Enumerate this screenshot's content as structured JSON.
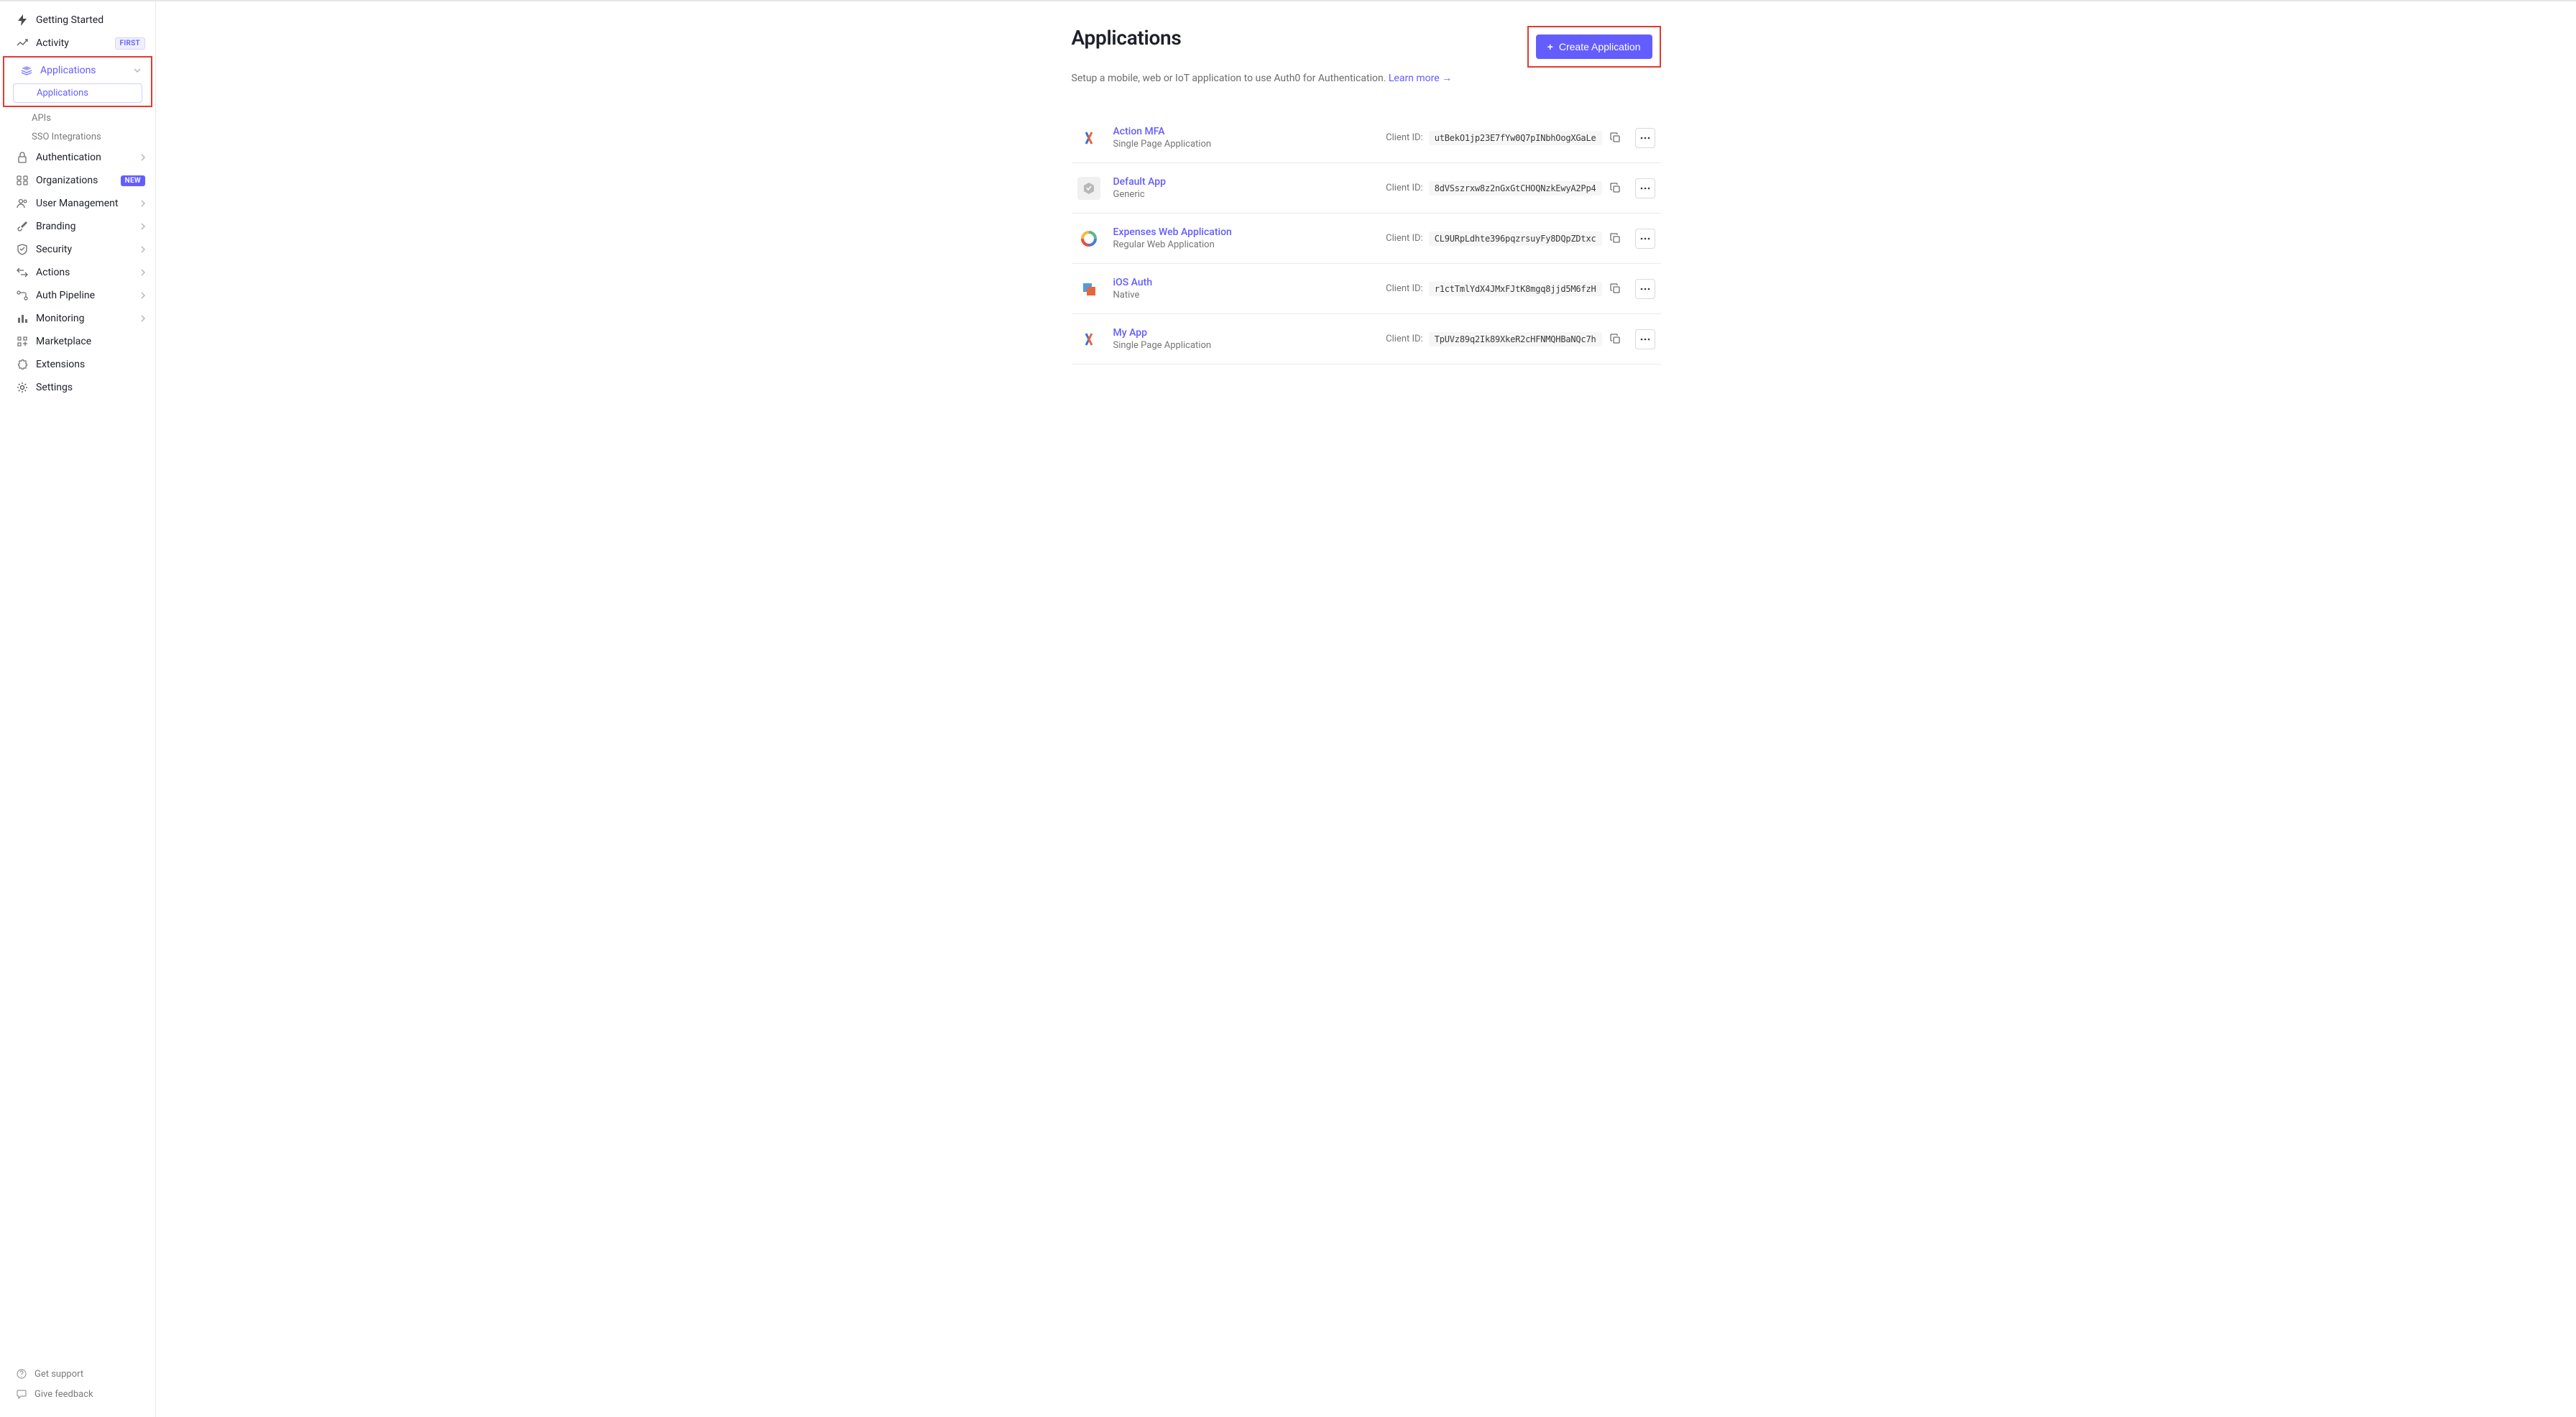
{
  "sidebar": {
    "items": [
      {
        "label": "Getting Started",
        "icon": "bolt"
      },
      {
        "label": "Activity",
        "icon": "chart",
        "badge": "FIRST",
        "badgeClass": "first"
      },
      {
        "label": "Applications",
        "icon": "layers",
        "hasChevDown": true,
        "activeParent": true,
        "subItems": [
          "Applications",
          "APIs",
          "SSO Integrations"
        ],
        "selectedSub": 0
      },
      {
        "label": "Authentication",
        "icon": "lock",
        "hasChev": true
      },
      {
        "label": "Organizations",
        "icon": "org",
        "badge": "NEW",
        "badgeClass": "new"
      },
      {
        "label": "User Management",
        "icon": "users",
        "hasChev": true
      },
      {
        "label": "Branding",
        "icon": "brush",
        "hasChev": true
      },
      {
        "label": "Security",
        "icon": "shield",
        "hasChev": true
      },
      {
        "label": "Actions",
        "icon": "arrows",
        "hasChev": true
      },
      {
        "label": "Auth Pipeline",
        "icon": "pipeline",
        "hasChev": true
      },
      {
        "label": "Monitoring",
        "icon": "bars",
        "hasChev": true
      },
      {
        "label": "Marketplace",
        "icon": "grid"
      },
      {
        "label": "Extensions",
        "icon": "puzzle"
      },
      {
        "label": "Settings",
        "icon": "gear"
      }
    ],
    "footer": [
      {
        "label": "Get support",
        "icon": "help"
      },
      {
        "label": "Give feedback",
        "icon": "comment"
      }
    ]
  },
  "page": {
    "title": "Applications",
    "subtitle_prefix": "Setup a mobile, web or IoT application to use Auth0 for Authentication. ",
    "learn_more": "Learn more →",
    "create_button": "Create Application",
    "client_id_label": "Client ID:"
  },
  "apps": [
    {
      "name": "Action MFA",
      "type": "Single Page Application",
      "clientId": "utBekO1jp23E7fYw0Q7pINbhOogXGaLe",
      "iconKind": "spa"
    },
    {
      "name": "Default App",
      "type": "Generic",
      "clientId": "8dVSszrxw8z2nGxGtCHOQNzkEwyA2Pp4",
      "iconKind": "generic"
    },
    {
      "name": "Expenses Web Application",
      "type": "Regular Web Application",
      "clientId": "CL9URpLdhte396pqzrsuyFy8DQpZDtxc",
      "iconKind": "rwa"
    },
    {
      "name": "iOS Auth",
      "type": "Native",
      "clientId": "r1ctTmlYdX4JMxFJtK8mgq8jjd5M6fzH",
      "iconKind": "native"
    },
    {
      "name": "My App",
      "type": "Single Page Application",
      "clientId": "TpUVz89q2Ik89XkeR2cHFNMQHBaNQc7h",
      "iconKind": "spa"
    }
  ]
}
